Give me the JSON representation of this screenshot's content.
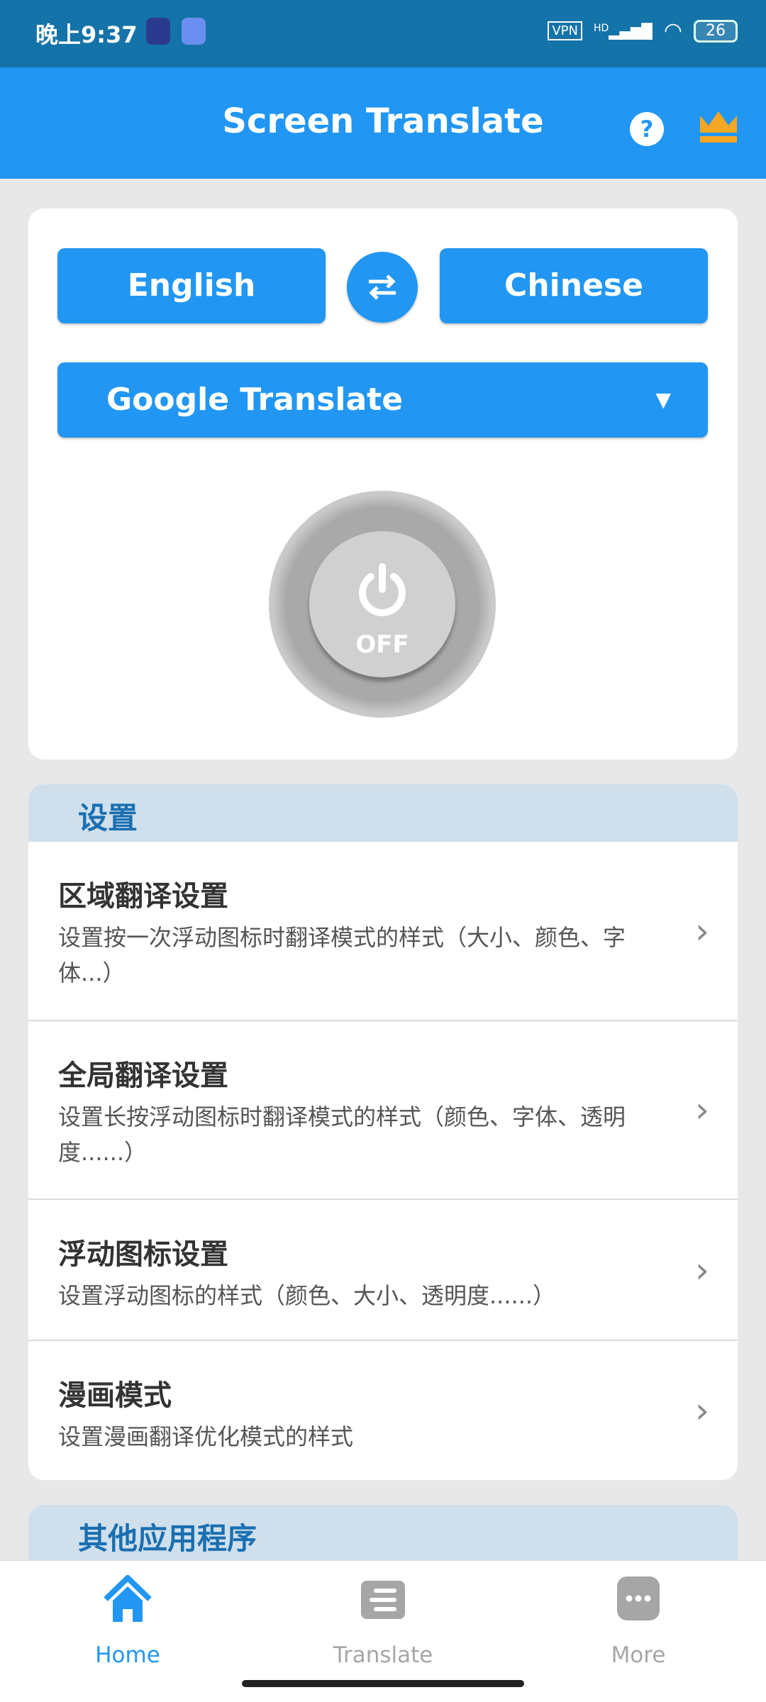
{
  "status_bar": {
    "time": "晚上9:37",
    "vpn": "VPN",
    "network": "HD",
    "battery": "26"
  },
  "app_bar": {
    "title": "Screen Translate",
    "icons": [
      "help-icon",
      "crown-icon"
    ]
  },
  "translator": {
    "source_language": "English",
    "target_language": "Chinese",
    "engine": "Google Translate",
    "power_state": "OFF"
  },
  "settings": {
    "header": "设置",
    "items": [
      {
        "title": "区域翻译设置",
        "subtitle": "设置按一次浮动图标时翻译模式的样式（大小、颜色、字体...）"
      },
      {
        "title": "全局翻译设置",
        "subtitle": "设置长按浮动图标时翻译模式的样式（颜色、字体、透明度......）"
      },
      {
        "title": "浮动图标设置",
        "subtitle": "设置浮动图标的样式（颜色、大小、透明度......）"
      },
      {
        "title": "漫画模式",
        "subtitle": "设置漫画翻译优化模式的样式"
      }
    ]
  },
  "other_apps": {
    "header": "其他应用程序"
  },
  "bottom_nav": {
    "items": [
      {
        "label": "Home",
        "active": true
      },
      {
        "label": "Translate",
        "active": false
      },
      {
        "label": "More",
        "active": false
      }
    ]
  },
  "colors": {
    "primary": "#2196f3",
    "status_bar": "#1473a8",
    "inactive": "#a6a6a6",
    "crown": "#f5a623"
  }
}
